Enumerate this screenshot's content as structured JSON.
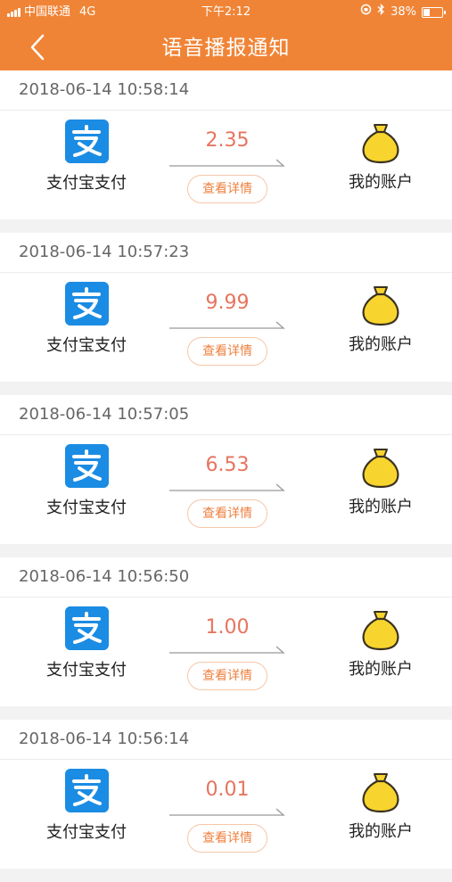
{
  "status_bar": {
    "carrier": "中国联通",
    "network": "4G",
    "time": "下午2:12",
    "battery": "38%",
    "battery_level": 0.38
  },
  "header": {
    "title": "语音播报通知"
  },
  "colors": {
    "header": "#f08436",
    "amount": "#e7745e",
    "alipay": "#1b8ce3",
    "bag": "#f8d52e"
  },
  "notifications": [
    {
      "time": "2018-06-14 10:58:14",
      "source": "支付宝支付",
      "amount": "2.35",
      "detail_label": "查看详情",
      "destination": "我的账户"
    },
    {
      "time": "2018-06-14 10:57:23",
      "source": "支付宝支付",
      "amount": "9.99",
      "detail_label": "查看详情",
      "destination": "我的账户"
    },
    {
      "time": "2018-06-14 10:57:05",
      "source": "支付宝支付",
      "amount": "6.53",
      "detail_label": "查看详情",
      "destination": "我的账户"
    },
    {
      "time": "2018-06-14 10:56:50",
      "source": "支付宝支付",
      "amount": "1.00",
      "detail_label": "查看详情",
      "destination": "我的账户"
    },
    {
      "time": "2018-06-14 10:56:14",
      "source": "支付宝支付",
      "amount": "0.01",
      "detail_label": "查看详情",
      "destination": "我的账户"
    }
  ]
}
